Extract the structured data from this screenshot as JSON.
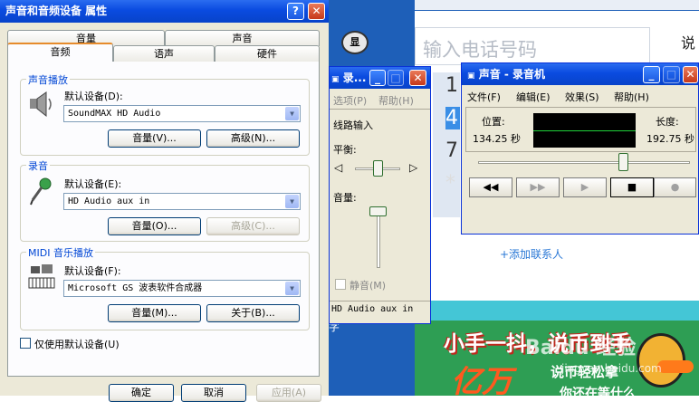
{
  "background": {
    "phone_placeholder": "输入电话号码",
    "side_label": "说",
    "keypad_digits": [
      "1",
      "4",
      "7",
      "*"
    ],
    "add_contact": "+添加联系人",
    "side_text": "字",
    "promo": {
      "line1": "小手一抖，说币到手",
      "big": "亿万",
      "line2": "说币轻松拿",
      "line3": "你还在等什么"
    },
    "watermark": "Baidu 经验",
    "watermark_sub": "jingyan.baidu.com"
  },
  "dialog": {
    "title": "声音和音频设备 属性",
    "help_glyph": "?",
    "close_glyph": "✕",
    "tabs_row1": [
      "音量",
      "声音"
    ],
    "tabs_row2": [
      "音频",
      "语声",
      "硬件"
    ],
    "playback": {
      "title": "声音播放",
      "default_label": "默认设备(D):",
      "device": "SoundMAX HD Audio",
      "volume_btn": "音量(V)...",
      "advanced_btn": "高级(N)..."
    },
    "recording": {
      "title": "录音",
      "default_label": "默认设备(E):",
      "device": "HD Audio aux in",
      "volume_btn": "音量(O)...",
      "advanced_btn": "高级(C)..."
    },
    "midi": {
      "title": "MIDI 音乐播放",
      "default_label": "默认设备(F):",
      "device": "Microsoft GS 波表软件合成器",
      "volume_btn": "音量(M)...",
      "about_btn": "关于(B)..."
    },
    "only_default": "仅使用默认设备(U)",
    "ok": "确定",
    "cancel": "取消",
    "apply": "应用(A)"
  },
  "mixer": {
    "title": "录...",
    "menu": [
      "选项(P)",
      "帮助(H)"
    ],
    "channel": "线路输入",
    "balance": "平衡:",
    "volume": "音量:",
    "mute": "静音(M)",
    "footer": "HD Audio aux in"
  },
  "recorder": {
    "title": "声音 - 录音机",
    "menu": [
      "文件(F)",
      "编辑(E)",
      "效果(S)",
      "帮助(H)"
    ],
    "position_label": "位置:",
    "position_value": "134.25 秒",
    "length_label": "长度:",
    "length_value": "192.75 秒",
    "position_fraction": 0.6965,
    "buttons": [
      "◀◀",
      "▶▶",
      "▶",
      "■",
      "●"
    ]
  }
}
